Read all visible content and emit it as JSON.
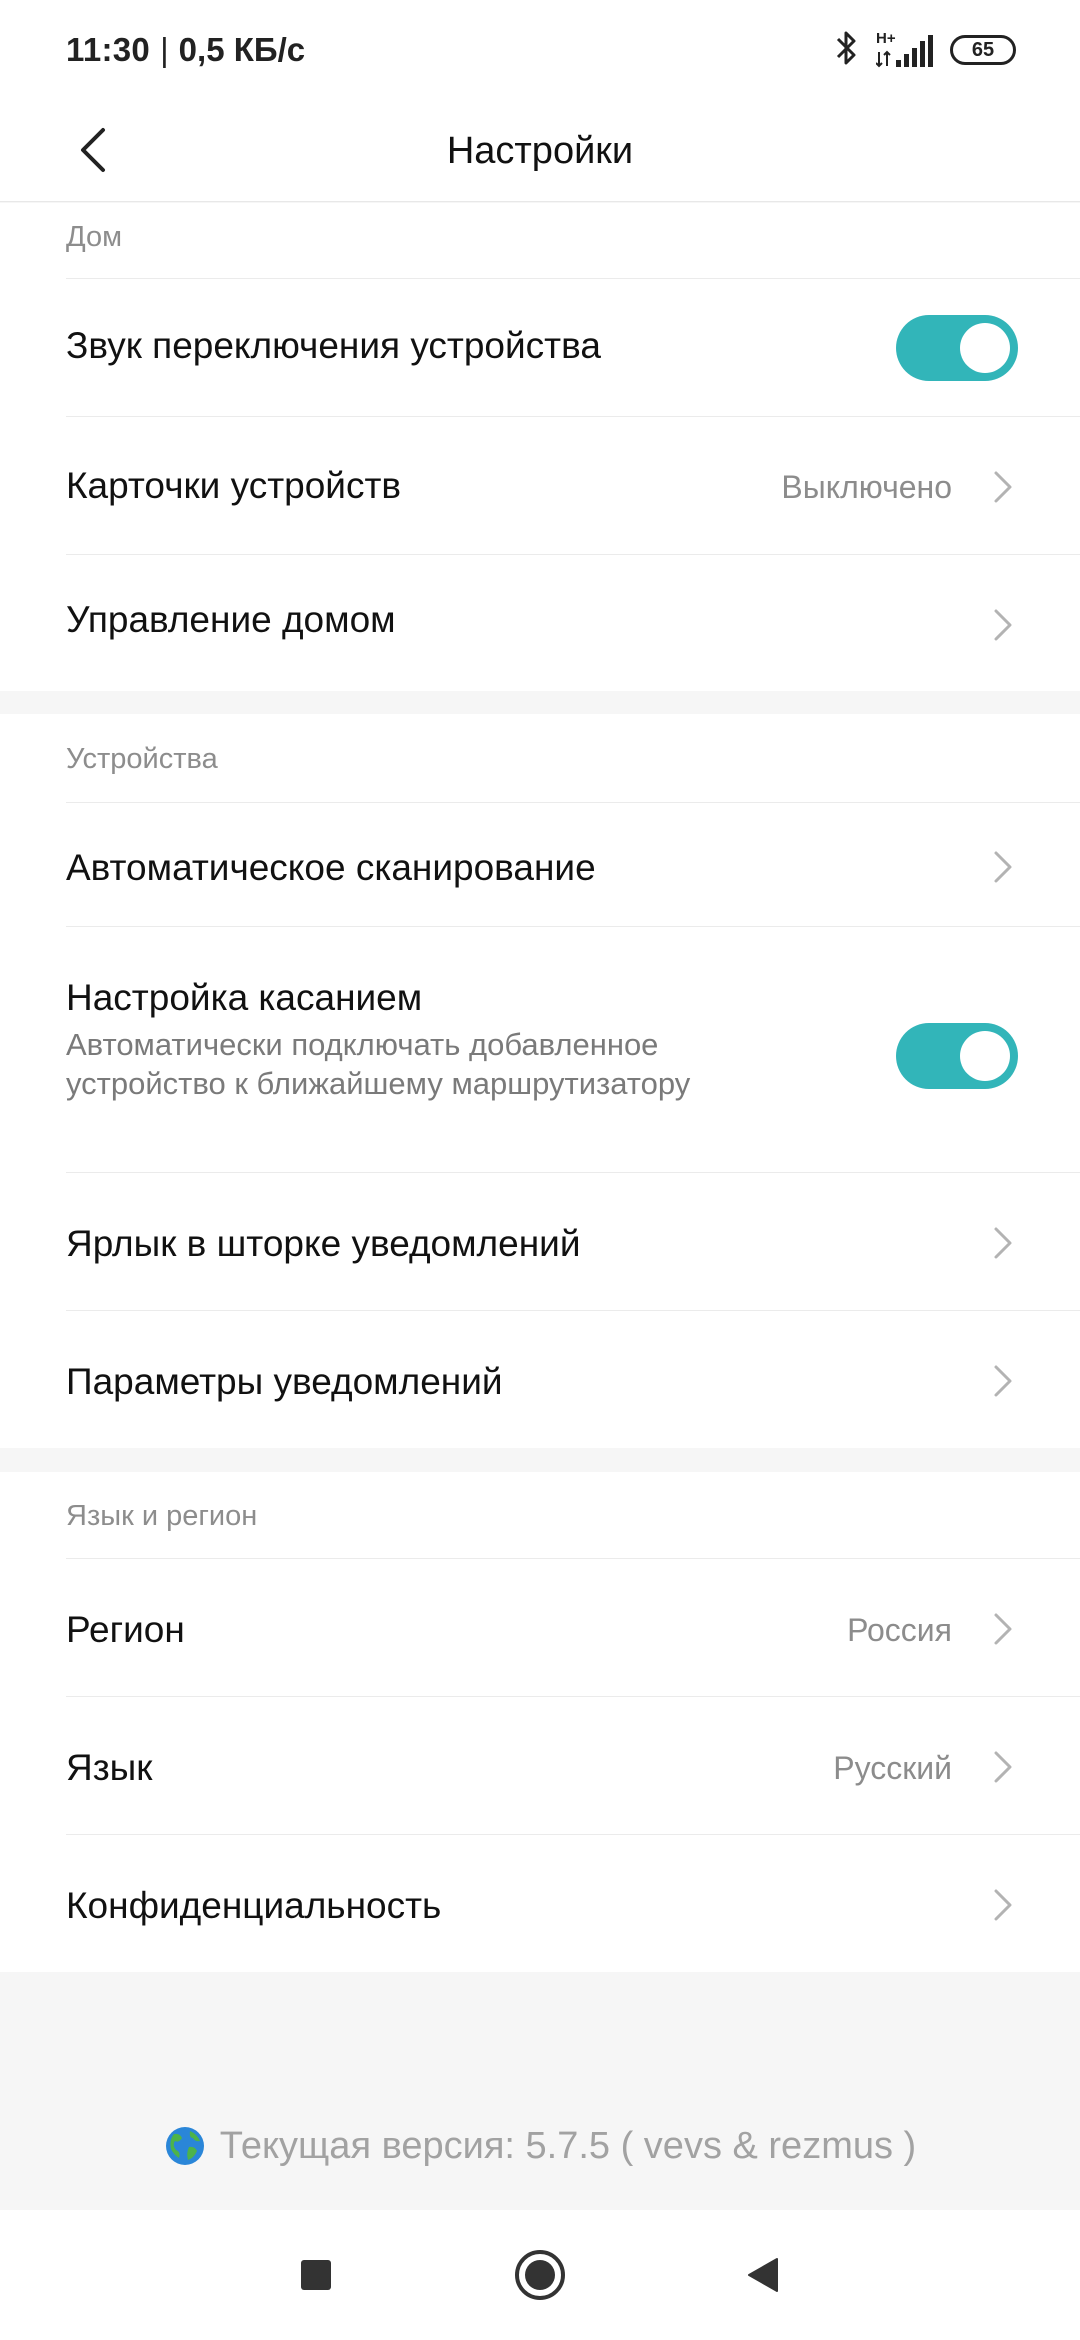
{
  "status_bar": {
    "time": "11:30",
    "separator": "|",
    "speed": "0,5 КБ/с",
    "network": "H+",
    "battery": "65"
  },
  "header": {
    "title": "Настройки"
  },
  "sections": {
    "home": {
      "label": "Дом",
      "device_sound": "Звук переключения устройства",
      "device_cards": "Карточки устройств",
      "device_cards_value": "Выключено",
      "home_management": "Управление домом"
    },
    "devices": {
      "label": "Устройства",
      "auto_scan": "Автоматическое сканирование",
      "touch_setup": "Настройка касанием",
      "touch_setup_desc": "Автоматически подключать добавленное устройство к ближайшему маршрутизатору",
      "notification_shortcut": "Ярлык в шторке уведомлений",
      "notification_params": "Параметры уведомлений"
    },
    "language_region": {
      "label": "Язык и регион",
      "region": "Регион",
      "region_value": "Россия",
      "language": "Язык",
      "language_value": "Русский",
      "privacy": "Конфиденциальность"
    }
  },
  "toggles": {
    "device_sound_on": true,
    "touch_setup_on": true
  },
  "footer": {
    "version": "Текущая версия: 5.7.5 ( vevs & rezmus )"
  },
  "colors": {
    "accent": "#32b5b9",
    "background": "#f6f6f6",
    "secondary_text": "#8c8c8c"
  },
  "icons": {
    "back": "back-chevron-icon",
    "chevron": "chevron-right-icon",
    "globe": "globe-icon",
    "bluetooth": "bluetooth-icon",
    "signal": "signal-icon"
  }
}
